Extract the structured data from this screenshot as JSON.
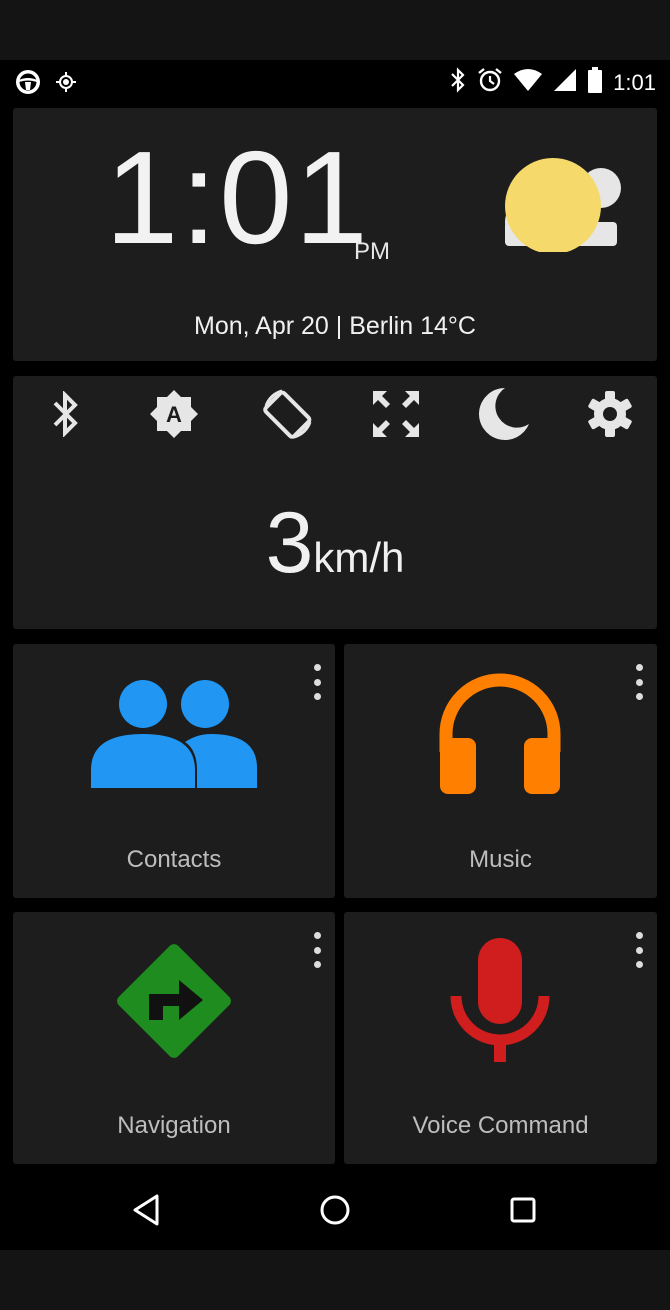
{
  "status_bar": {
    "time": "1:01",
    "left_icons": [
      "steering-wheel-icon",
      "gps-icon"
    ],
    "right_icons": [
      "bluetooth-icon",
      "alarm-icon",
      "wifi-icon",
      "signal-icon",
      "battery-icon"
    ]
  },
  "clock": {
    "time": "1:01",
    "ampm": "PM",
    "date_weather": "Mon, Apr 20 | Berlin 14°C",
    "weather_icon": "partly-cloudy-icon"
  },
  "controls": {
    "buttons": [
      "bluetooth-icon",
      "auto-brightness-icon",
      "screen-rotation-icon",
      "fullscreen-icon",
      "night-mode-icon",
      "settings-gear-icon"
    ],
    "speed_value": "3",
    "speed_unit": "km/h"
  },
  "tiles": [
    {
      "label": "Contacts",
      "icon": "contacts-icon",
      "color": "#2196F3"
    },
    {
      "label": "Music",
      "icon": "headphones-icon",
      "color": "#FF8000"
    },
    {
      "label": "Navigation",
      "icon": "navigation-sign-icon",
      "color": "#1E8C1E"
    },
    {
      "label": "Voice Command",
      "icon": "microphone-icon",
      "color": "#D01E1E"
    }
  ],
  "nav_bar": [
    "back-icon",
    "home-icon",
    "recents-icon"
  ]
}
